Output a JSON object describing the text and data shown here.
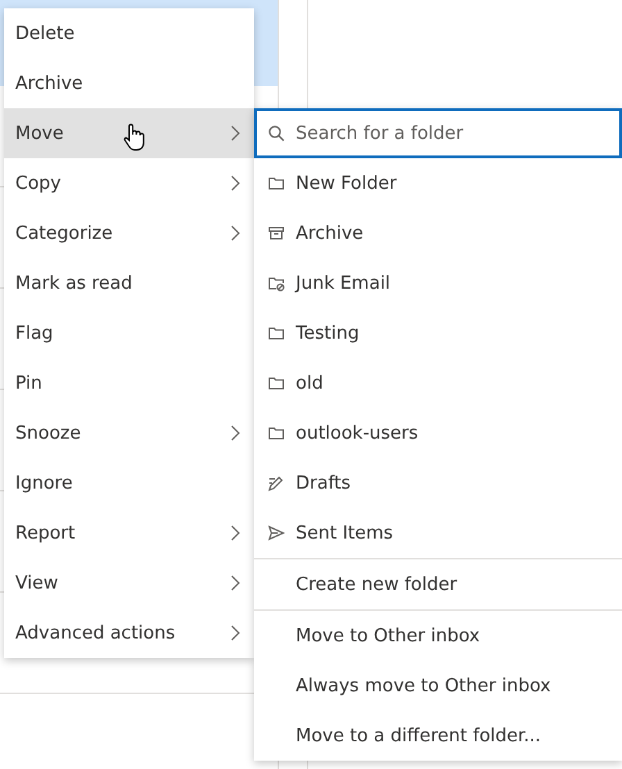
{
  "context_menu": {
    "items": [
      {
        "label": "Delete",
        "kind": "action",
        "highlighted": false
      },
      {
        "label": "Archive",
        "kind": "action",
        "highlighted": false
      },
      {
        "label": "Move",
        "kind": "submenu",
        "highlighted": true
      },
      {
        "label": "Copy",
        "kind": "submenu",
        "highlighted": false
      },
      {
        "label": "Categorize",
        "kind": "submenu",
        "highlighted": false
      },
      {
        "label": "Mark as read",
        "kind": "action",
        "highlighted": false
      },
      {
        "label": "Flag",
        "kind": "action",
        "highlighted": false
      },
      {
        "label": "Pin",
        "kind": "action",
        "highlighted": false
      },
      {
        "label": "Snooze",
        "kind": "submenu",
        "highlighted": false
      },
      {
        "label": "Ignore",
        "kind": "action",
        "highlighted": false
      },
      {
        "label": "Report",
        "kind": "submenu",
        "highlighted": false
      },
      {
        "label": "View",
        "kind": "submenu",
        "highlighted": false
      },
      {
        "label": "Advanced actions",
        "kind": "submenu",
        "highlighted": false
      }
    ]
  },
  "move_submenu": {
    "search": {
      "placeholder": "Search for a folder"
    },
    "sections": [
      [
        {
          "label": "New Folder",
          "kind": "folder"
        },
        {
          "label": "Archive",
          "kind": "archive"
        },
        {
          "label": "Junk Email",
          "kind": "junk"
        },
        {
          "label": "Testing",
          "kind": "folder"
        },
        {
          "label": "old",
          "kind": "folder"
        },
        {
          "label": "outlook-users",
          "kind": "folder"
        },
        {
          "label": "Drafts",
          "kind": "drafts"
        },
        {
          "label": "Sent Items",
          "kind": "sent"
        }
      ],
      [
        {
          "label": "Create new folder",
          "kind": "action"
        }
      ],
      [
        {
          "label": "Move to Other inbox",
          "kind": "action"
        },
        {
          "label": "Always move to Other inbox",
          "kind": "action"
        },
        {
          "label": "Move to a different folder...",
          "kind": "action"
        }
      ]
    ]
  }
}
